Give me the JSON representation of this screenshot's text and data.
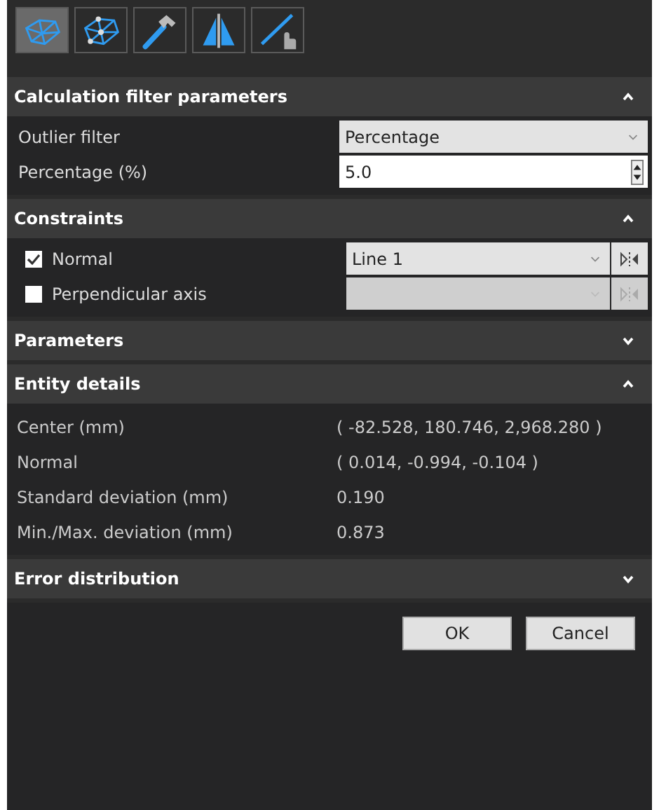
{
  "toolbar": [
    {
      "kind": "mesh",
      "selected": true
    },
    {
      "kind": "mesh-points",
      "selected": false
    },
    {
      "kind": "hammer",
      "selected": false
    },
    {
      "kind": "mirror",
      "selected": false
    },
    {
      "kind": "line-pick",
      "selected": false
    }
  ],
  "sections": [
    {
      "title": "Calculation filter parameters",
      "expanded": true,
      "rows": [
        {
          "kind": "dropdown",
          "label": "Outlier filter",
          "value": "Percentage"
        },
        {
          "kind": "spinner",
          "label": "Percentage (%)",
          "value": "5.0"
        }
      ]
    },
    {
      "title": "Constraints",
      "expanded": true,
      "rows": [
        {
          "kind": "check-dropdown",
          "label": "Normal",
          "checked": true,
          "disabled": false,
          "value": "Line 1"
        },
        {
          "kind": "check-dropdown",
          "label": "Perpendicular axis",
          "checked": false,
          "disabled": true
        }
      ]
    },
    {
      "title": "Parameters",
      "expanded": false
    },
    {
      "title": "Entity details",
      "expanded": true,
      "rows": [
        {
          "kind": "info",
          "label": "Center (mm)",
          "value": "( -82.528, 180.746, 2,968.280 )"
        },
        {
          "kind": "info",
          "label": "Normal",
          "value": "( 0.014, -0.994, -0.104 )"
        },
        {
          "kind": "info",
          "label": "Standard deviation (mm)",
          "value": "0.190"
        },
        {
          "kind": "info",
          "label": "Min./Max. deviation (mm)",
          "value": "0.873"
        }
      ]
    },
    {
      "title": "Error distribution",
      "expanded": false
    }
  ],
  "buttons": [
    {
      "label": "OK"
    },
    {
      "label": "Cancel"
    }
  ]
}
